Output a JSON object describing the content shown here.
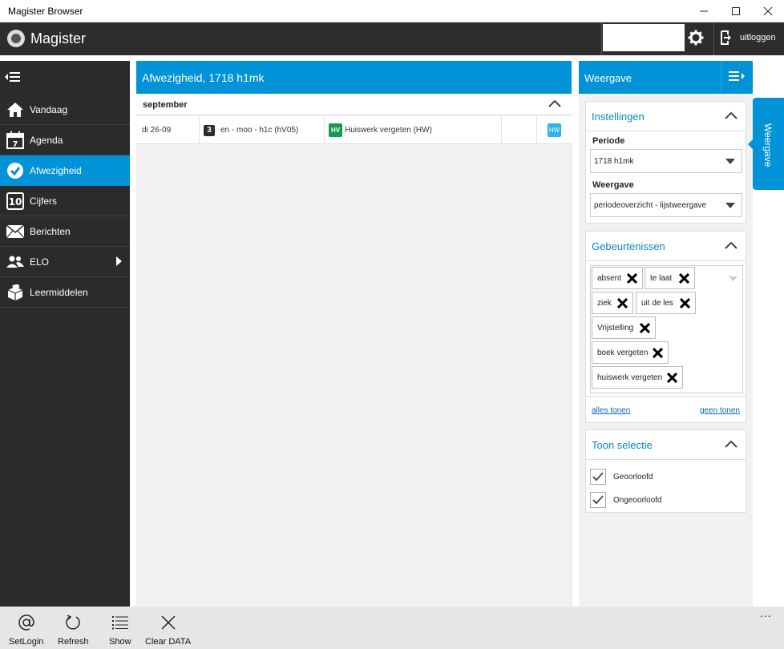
{
  "window": {
    "title": "Magister Browser"
  },
  "header": {
    "app_title": "Magister",
    "logout_label": "uitloggen"
  },
  "sidebar": {
    "items": [
      {
        "label": "Vandaag"
      },
      {
        "label": "Agenda"
      },
      {
        "label": "Afwezigheid"
      },
      {
        "label": "Cijfers"
      },
      {
        "label": "Berichten"
      },
      {
        "label": "ELO"
      },
      {
        "label": "Leermiddelen"
      }
    ]
  },
  "main": {
    "title": "Afwezigheid, 1718 h1mk",
    "month": "september",
    "rows": [
      {
        "date": "di 26-09",
        "hour": "3",
        "lesson": "en - moo - h1c (hV05)",
        "event_code": "HV",
        "event": "Huiswerk vergeten (HW)",
        "badge": "HW"
      }
    ]
  },
  "panel": {
    "title": "Weergave",
    "side_tab": "Weergave",
    "instellingen": {
      "title": "Instellingen",
      "periode_label": "Periode",
      "periode_value": "1718 h1mk",
      "weergave_label": "Weergave",
      "weergave_value": "periodeoverzicht - lijstweergave"
    },
    "gebeurtenissen": {
      "title": "Gebeurtenissen",
      "tags": [
        "absent",
        "te laat",
        "ziek",
        "uit de les",
        "Vrijstelling",
        "boek vergeten",
        "huiswerk vergeten"
      ],
      "show_all": "alles tonen",
      "show_none": "geen tonen"
    },
    "toon_selectie": {
      "title": "Toon selectie",
      "options": [
        "Geoorloofd",
        "Ongeoorloofd"
      ]
    }
  },
  "appbar": {
    "buttons": [
      {
        "label": "SetLogin"
      },
      {
        "label": "Refresh"
      },
      {
        "label": "Show"
      },
      {
        "label": "Clear DATA"
      }
    ],
    "more": "..."
  },
  "colors": {
    "accent": "#0093d7",
    "sidebar": "#2b2b2b",
    "header": "#2d2d2d",
    "hv_green": "#169b52"
  }
}
